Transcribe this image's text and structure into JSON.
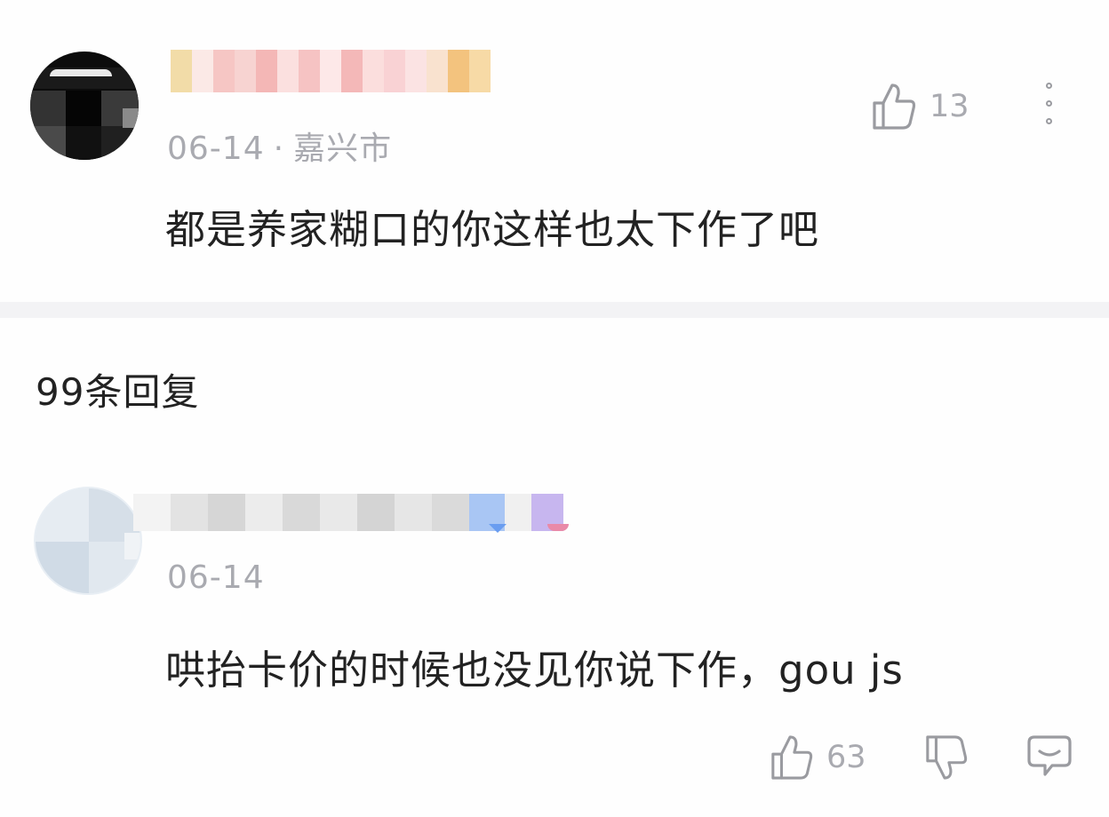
{
  "comment": {
    "date": "06-14",
    "separator": "·",
    "location": "嘉兴市",
    "text": "都是养家糊口的你这样也太下作了吧",
    "like_count": "13",
    "icons": {
      "like": "thumbs-up-icon",
      "more": "more-vertical-icon"
    }
  },
  "replies_header": {
    "label": "99条回复"
  },
  "reply": {
    "date": "06-14",
    "text": "哄抬卡价的时候也没见你说下作，gou js",
    "like_count": "63",
    "icons": {
      "like": "thumbs-up-icon",
      "dislike": "thumbs-down-icon",
      "reply": "comment-bubble-icon"
    }
  },
  "colors": {
    "text_primary": "#222222",
    "text_secondary": "#a9aab0",
    "icon_stroke": "#9a9ba0",
    "divider": "#f3f3f5",
    "background": "#fefefe"
  }
}
